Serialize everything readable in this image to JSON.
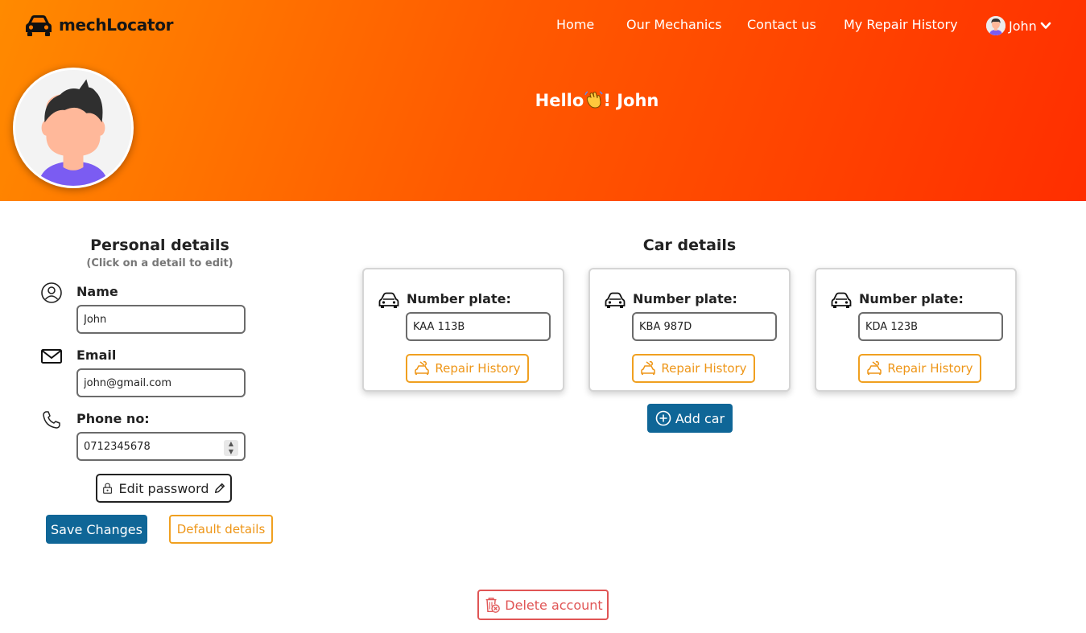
{
  "app": {
    "brand_name": "mechLocator"
  },
  "nav": {
    "items": [
      "Home",
      "Our Mechanics",
      "Contact us",
      "My Repair History"
    ],
    "user_name": "John"
  },
  "greeting": {
    "prefix": "Hello",
    "suffix": "! John"
  },
  "personal": {
    "title": "Personal details",
    "hint": "(Click on a detail to edit)",
    "name_label": "Name",
    "name_value": "John",
    "email_label": "Email",
    "email_value": "john@gmail.com",
    "phone_label": "Phone no:",
    "phone_value": "0712345678",
    "edit_password_label": "Edit password",
    "save_label": "Save Changes",
    "default_label": "Default details"
  },
  "cars": {
    "title": "Car details",
    "plate_label": "Number plate:",
    "history_label": "Repair History",
    "list": [
      {
        "plate": "KAA 113B"
      },
      {
        "plate": "KBA 987D"
      },
      {
        "plate": "KDA 123B"
      }
    ],
    "add_label": "Add car"
  },
  "account": {
    "delete_label": "Delete account"
  },
  "colors": {
    "primary": "#0f6697",
    "accent": "#f0a020",
    "danger": "#e05555",
    "hero_start": "#ff8a00",
    "hero_end": "#ff2e00"
  },
  "icons": [
    "car-icon",
    "user-circle-icon",
    "mail-icon",
    "phone-icon",
    "lock-icon",
    "pencil-icon",
    "plus-circle-icon",
    "mechanic-car-icon",
    "trash-icon",
    "chevron-down-icon",
    "wave-icon"
  ]
}
